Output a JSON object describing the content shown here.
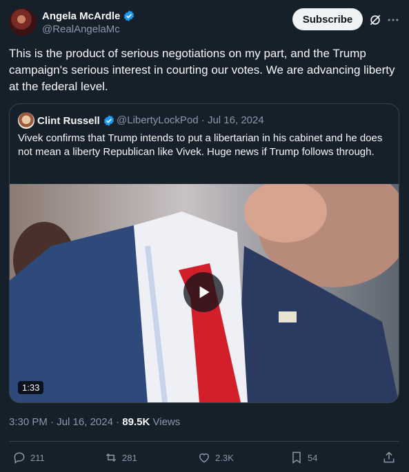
{
  "author": {
    "name": "Angela McArdle",
    "handle": "@RealAngelaMc"
  },
  "header": {
    "subscribe_label": "Subscribe"
  },
  "tweet": {
    "text": "This is the product of serious negotiations on my part, and the Trump campaign's serious interest in courting our votes. We are advancing liberty at the federal level."
  },
  "quote": {
    "name": "Clint Russell",
    "handle": "@LibertyLockPod",
    "date": "Jul 16, 2024",
    "text": "Vivek confirms that Trump intends to put a libertarian in his cabinet and he does not mean a liberty Republican like Vivek. Huge news if Trump follows through.",
    "video_duration": "1:33"
  },
  "meta": {
    "time": "3:30 PM",
    "date": "Jul 16, 2024",
    "views_count": "89.5K",
    "views_label": "Views"
  },
  "actions": {
    "replies": "211",
    "reposts": "281",
    "likes": "2.3K",
    "bookmarks": "54"
  },
  "colors": {
    "background": "#15202b",
    "verified": "#1d9bf0",
    "muted_text": "#8b98a5"
  }
}
